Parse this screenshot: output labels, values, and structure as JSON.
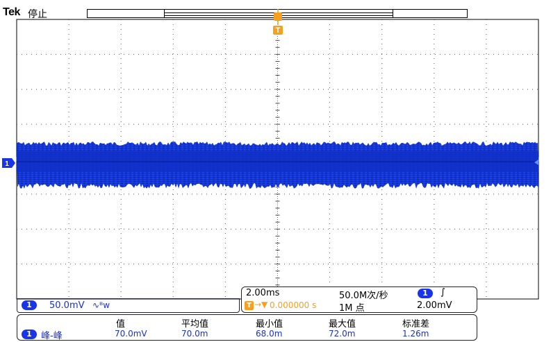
{
  "header": {
    "brand": "Tek",
    "state": "停止"
  },
  "trigger_marker": "T",
  "channel_marker": "1",
  "channel_info": {
    "channel": "1",
    "scale": "50.0mV",
    "coupling_icon": "∿ᴮw"
  },
  "timebase": {
    "time_per_div": "2.00ms",
    "sample_rate": "50.0M次/秒",
    "trigger_channel": "1",
    "trigger_slope": "∫",
    "trigger_position_label": "T",
    "trigger_position": "0.000000 s",
    "record_length": "1M 点",
    "trigger_level": "2.00mV"
  },
  "measurements": {
    "channel": "1",
    "name": "峰-峰",
    "headers": [
      "值",
      "平均值",
      "最小值",
      "最大值",
      "标准差"
    ],
    "values": [
      "70.0mV",
      "70.0m",
      "68.0m",
      "72.0m",
      "1.26m"
    ]
  },
  "colors": {
    "trace": "#1437d8",
    "trace_core": "#0a1a8a",
    "marker": "#f5a020",
    "grid": "#000000"
  }
}
